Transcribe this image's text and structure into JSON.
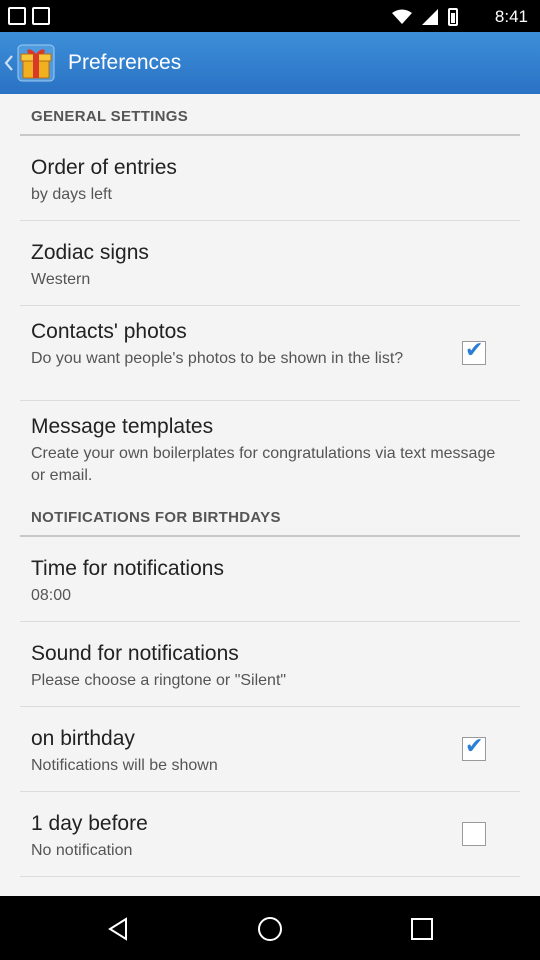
{
  "status": {
    "time": "8:41"
  },
  "header": {
    "title": "Preferences"
  },
  "sections": [
    {
      "title": "GENERAL SETTINGS"
    },
    {
      "title": "NOTIFICATIONS FOR BIRTHDAYS"
    }
  ],
  "items": [
    {
      "title": "Order of entries",
      "summary": "by days left"
    },
    {
      "title": "Zodiac signs",
      "summary": "Western"
    },
    {
      "title": "Contacts' photos",
      "summary": "Do you want people's photos to be shown in the list?",
      "checked": true
    },
    {
      "title": "Message templates",
      "summary": "Create your own boilerplates for congratulations via text message or email."
    },
    {
      "title": "Time for notifications",
      "summary": "08:00"
    },
    {
      "title": "Sound for notifications",
      "summary": "Please choose a ringtone or \"Silent\""
    },
    {
      "title": "on birthday",
      "summary": "Notifications will be shown",
      "checked": true
    },
    {
      "title": "1 day before",
      "summary": "No notification",
      "checked": false
    }
  ],
  "icons": {
    "app": "gift-icon",
    "back": "chevron-left-icon",
    "nav": [
      "back-triangle-icon",
      "home-circle-icon",
      "recents-square-icon"
    ]
  },
  "colors": {
    "actionbar": "#2a72c4",
    "accent": "#2a7fd4"
  }
}
